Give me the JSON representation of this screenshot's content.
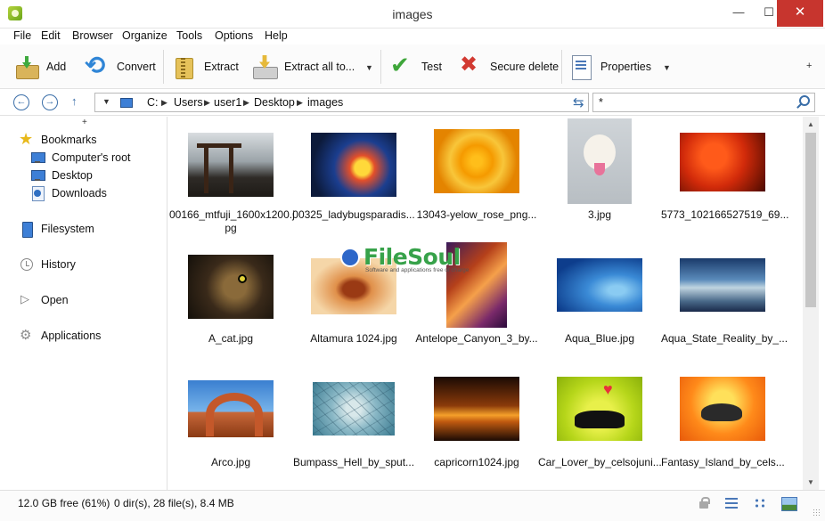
{
  "window": {
    "title": "images",
    "minimize": "—",
    "maximize": "☐",
    "close": "✕"
  },
  "menu": [
    "File",
    "Edit",
    "Browser",
    "Organize",
    "Tools",
    "Options",
    "Help"
  ],
  "toolbar": {
    "add": "Add",
    "convert": "Convert",
    "extract": "Extract",
    "extract_all": "Extract all to...",
    "test": "Test",
    "secure_delete": "Secure delete",
    "properties": "Properties",
    "more": "+"
  },
  "address": {
    "crumbs": [
      "C:",
      "Users",
      "user1",
      "Desktop",
      "images"
    ],
    "filter_value": "*"
  },
  "sidebar": {
    "expand": "+",
    "bookmarks": "Bookmarks",
    "bookmark_items": [
      "Computer's root",
      "Desktop",
      "Downloads"
    ],
    "filesystem": "Filesystem",
    "history": "History",
    "open": "Open",
    "applications": "Applications"
  },
  "files": [
    {
      "name": "00166_mtfuji_1600x1200.jpg",
      "label_line1": "00166_mtfuji_1600x1200.j",
      "label_line2": "pg",
      "art": "fuji"
    },
    {
      "name": "00325_ladybugsparadis...",
      "label_line1": "00325_ladybugsparadis...",
      "label_line2": "",
      "art": "lady"
    },
    {
      "name": "13043-yelow_rose_png...",
      "label_line1": "13043-yelow_rose_png...",
      "label_line2": "",
      "art": "rose"
    },
    {
      "name": "3.jpg",
      "label_line1": "3.jpg",
      "label_line2": "",
      "art": "dog"
    },
    {
      "name": "5773_102166527519_69...",
      "label_line1": "5773_102166527519_69...",
      "label_line2": "",
      "art": "drops"
    },
    {
      "name": "A_cat.jpg",
      "label_line1": "A_cat.jpg",
      "label_line2": "",
      "art": "cat"
    },
    {
      "name": "Altamura 1024.jpg",
      "label_line1": "Altamura 1024.jpg",
      "label_line2": "",
      "art": "altamura"
    },
    {
      "name": "Antelope_Canyon_3_by...",
      "label_line1": "Antelope_Canyon_3_by...",
      "label_line2": "",
      "art": "antelope"
    },
    {
      "name": "Aqua_Blue.jpg",
      "label_line1": "Aqua_Blue.jpg",
      "label_line2": "",
      "art": "aqua"
    },
    {
      "name": "Aqua_State_Reality_by_...",
      "label_line1": "Aqua_State_Reality_by_...",
      "label_line2": "",
      "art": "aquastate"
    },
    {
      "name": "Arco.jpg",
      "label_line1": "Arco.jpg",
      "label_line2": "",
      "art": "arco"
    },
    {
      "name": "Bumpass_Hell_by_sput...",
      "label_line1": "Bumpass_Hell_by_sput...",
      "label_line2": "",
      "art": "bumpass"
    },
    {
      "name": "capricorn1024.jpg",
      "label_line1": "capricorn1024.jpg",
      "label_line2": "",
      "art": "capricorn"
    },
    {
      "name": "Car_Lover_by_celsojuni...",
      "label_line1": "Car_Lover_by_celsojuni...",
      "label_line2": "",
      "art": "carlover"
    },
    {
      "name": "Fantasy_Island_by_cels...",
      "label_line1": "Fantasy_Island_by_cels...",
      "label_line2": "",
      "art": "fantasy"
    }
  ],
  "watermark": {
    "text": "FileSoul",
    "tagline": "Software and applications free of charge"
  },
  "status": {
    "free_space": "12.0 GB free (61%)",
    "summary": "0 dir(s), 28 file(s), 8.4 MB"
  }
}
